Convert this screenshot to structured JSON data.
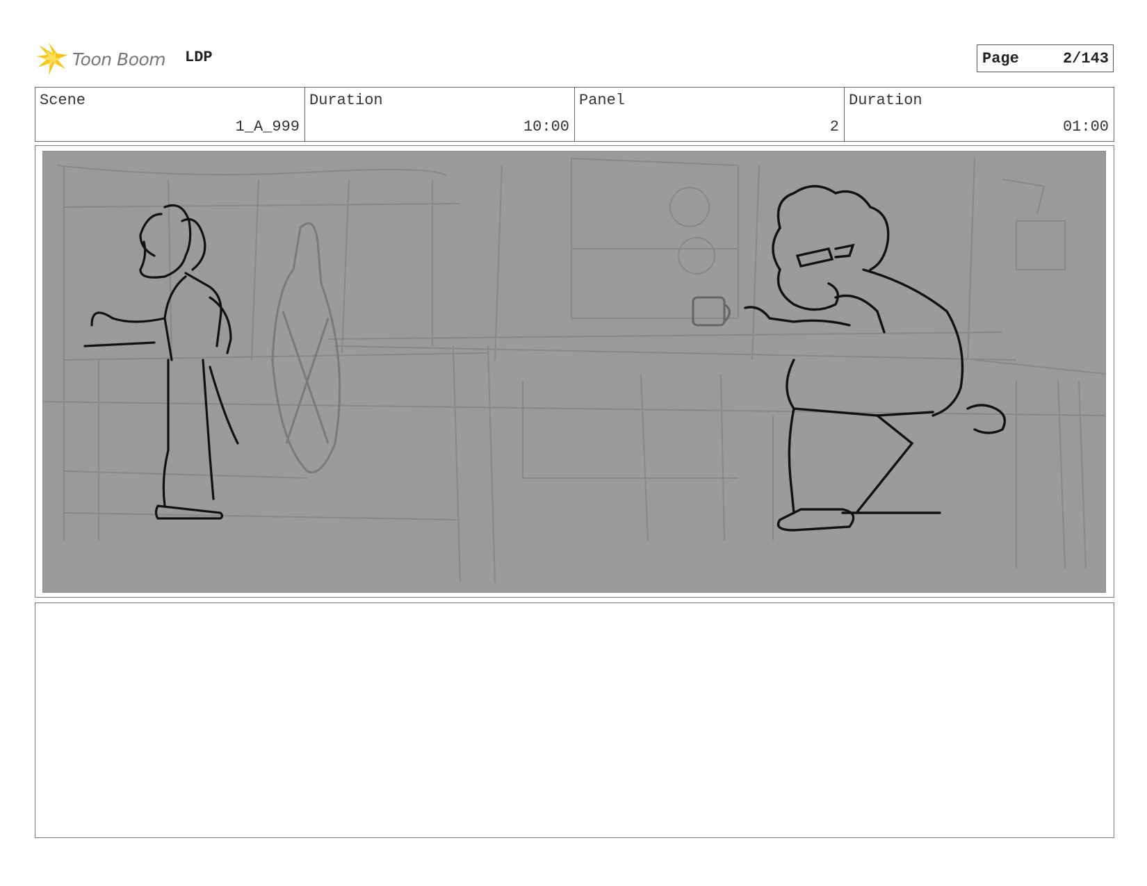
{
  "header": {
    "logo_text": "Toon Boom",
    "project_code": "LDP",
    "page_label": "Page",
    "page_number": "2/143"
  },
  "info": {
    "scene_label": "Scene",
    "scene_value": "1_A_999",
    "scene_duration_label": "Duration",
    "scene_duration_value": "10:00",
    "panel_label": "Panel",
    "panel_value": "2",
    "panel_duration_label": "Duration",
    "panel_duration_value": "01:00"
  },
  "panel_image": {
    "icon": "storyboard-sketch-image",
    "background_color": "#9a9a9a"
  },
  "colors": {
    "logo_accent": "#f5c518",
    "border": "#666666"
  }
}
